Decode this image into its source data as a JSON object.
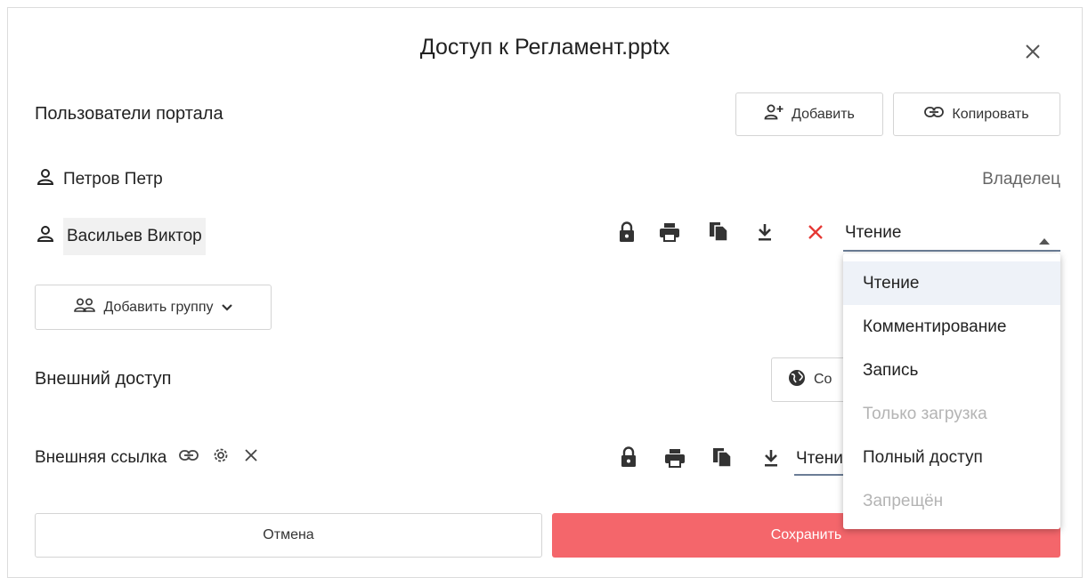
{
  "dialog": {
    "title": "Доступ к Регламент.pptx"
  },
  "portal": {
    "heading": "Пользователи портала",
    "add_label": "Добавить",
    "copy_label": "Копировать"
  },
  "users": [
    {
      "name": "Петров Петр",
      "role": "Владелец"
    },
    {
      "name": "Васильев Виктор",
      "role_selected": "Чтение"
    }
  ],
  "add_group_label": "Добавить группу",
  "external": {
    "heading": "Внешний доступ",
    "create_button_partial": "Со",
    "link_label": "Внешняя ссылка",
    "access_partial": "Чтени"
  },
  "dropdown_options": [
    {
      "label": "Чтение",
      "state": "selected"
    },
    {
      "label": "Комментирование",
      "state": "enabled"
    },
    {
      "label": "Запись",
      "state": "enabled"
    },
    {
      "label": "Только загрузка",
      "state": "disabled"
    },
    {
      "label": "Полный доступ",
      "state": "enabled"
    },
    {
      "label": "Запрещён",
      "state": "disabled"
    }
  ],
  "footer": {
    "cancel_label": "Отмена",
    "save_label": "Сохранить"
  },
  "colors": {
    "accent": "#f4666b",
    "remove": "#e53935",
    "icon": "#333333",
    "disabled_text": "#b4b4b4",
    "selected_bg": "#eef2f8"
  }
}
